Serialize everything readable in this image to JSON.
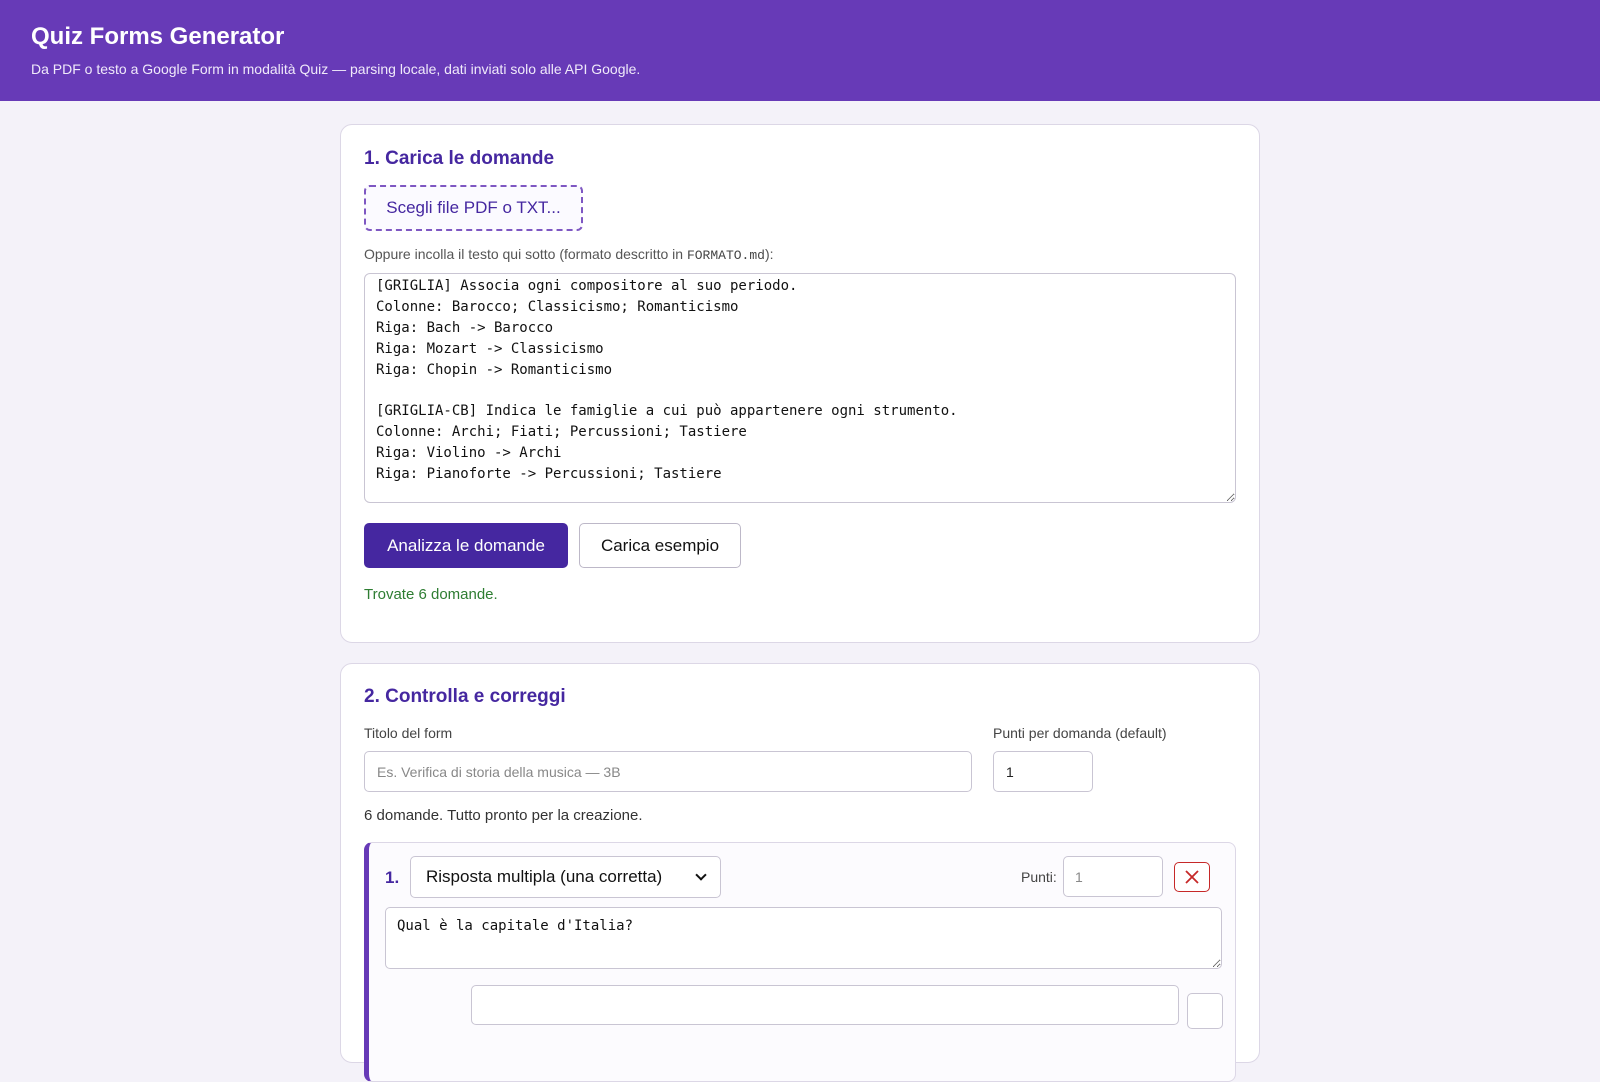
{
  "header": {
    "title": "Quiz Forms Generator",
    "subtitle": "Da PDF o testo a Google Form in modalità Quiz — parsing locale, dati inviati solo alle API Google."
  },
  "step1": {
    "heading": "1. Carica le domande",
    "file_button": "Scegli file PDF o TXT...",
    "hint_before": "Oppure incolla il testo qui sotto (formato descritto in ",
    "hint_code": "FORMATO.md",
    "hint_after": "):",
    "source_text": "[GRIGLIA] Associa ogni compositore al suo periodo.\nColonne: Barocco; Classicismo; Romanticismo\nRiga: Bach -> Barocco\nRiga: Mozart -> Classicismo\nRiga: Chopin -> Romanticismo\n\n[GRIGLIA-CB] Indica le famiglie a cui può appartenere ogni strumento.\nColonne: Archi; Fiati; Percussioni; Tastiere\nRiga: Violino -> Archi\nRiga: Pianoforte -> Percussioni; Tastiere",
    "analyze_button": "Analizza le domande",
    "example_button": "Carica esempio",
    "status": "Trovate 6 domande."
  },
  "step2": {
    "heading": "2. Controlla e correggi",
    "form_title_label": "Titolo del form",
    "form_title_placeholder": "Es. Verifica di storia della musica — 3B",
    "points_label": "Punti per domanda (default)",
    "points_value": "1",
    "summary": "6 domande. Tutto pronto per la creazione.",
    "question": {
      "number": "1.",
      "type": "Risposta multipla (una corretta)",
      "points_label": "Punti:",
      "points_value": "1",
      "text": "Qual è la capitale d'Italia?"
    }
  },
  "colors": {
    "header_bg": "#673ab7",
    "accent": "#4527a0",
    "success": "#2e7d32",
    "danger": "#c62828"
  },
  "icons": {
    "delete": "close-icon",
    "select": "chevron-down-icon"
  }
}
